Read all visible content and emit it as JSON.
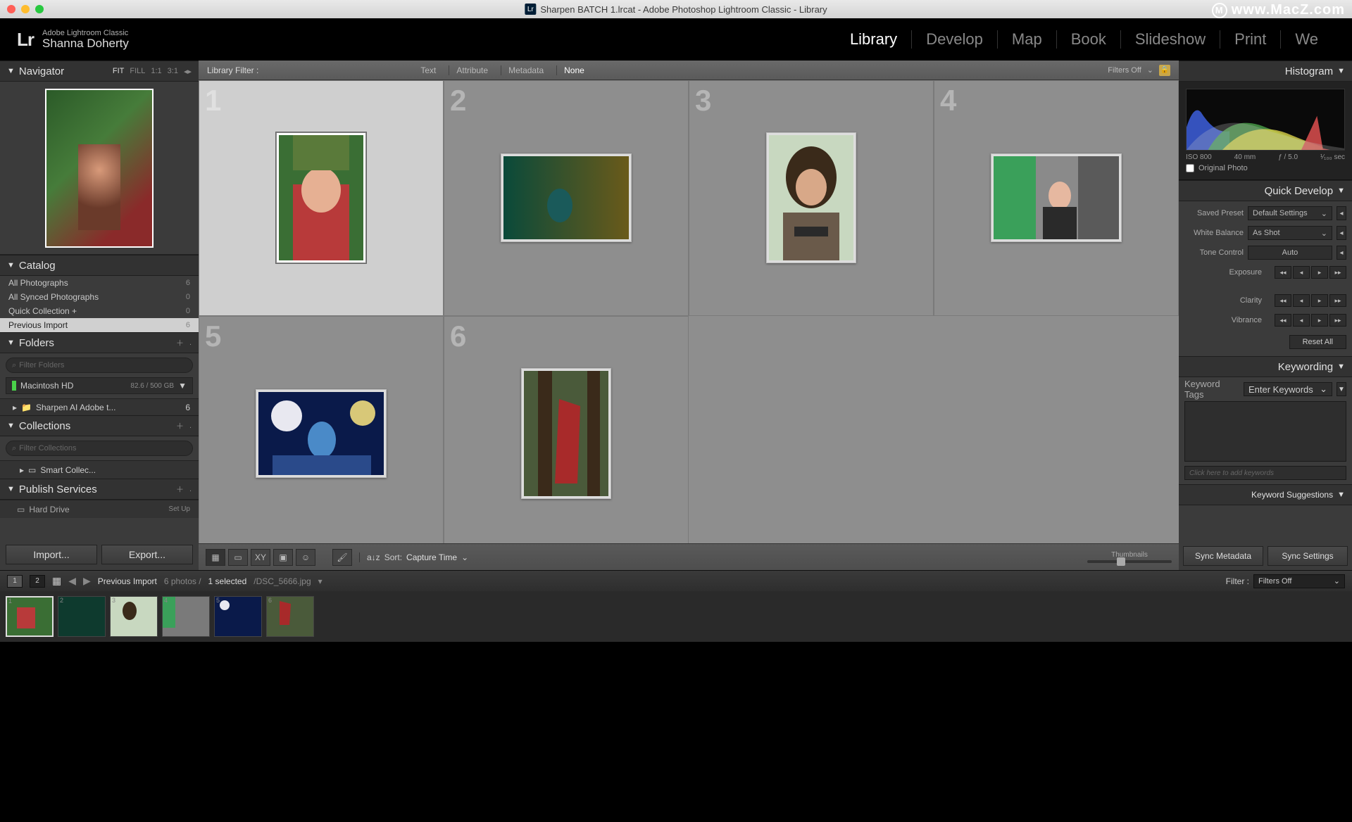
{
  "window_title": "Sharpen BATCH 1.lrcat - Adobe Photoshop Lightroom Classic - Library",
  "watermark": "www.MacZ.com",
  "identity": {
    "brand": "Lr",
    "product": "Adobe Lightroom Classic",
    "user": "Shanna Doherty"
  },
  "modules": [
    "Library",
    "Develop",
    "Map",
    "Book",
    "Slideshow",
    "Print",
    "We"
  ],
  "active_module": "Library",
  "navigator": {
    "title": "Navigator",
    "zoom_opts": [
      "FIT",
      "FILL",
      "1:1",
      "3:1"
    ],
    "zoom_active": "FIT"
  },
  "catalog": {
    "title": "Catalog",
    "items": [
      {
        "label": "All Photographs",
        "count": "6"
      },
      {
        "label": "All Synced Photographs",
        "count": "0"
      },
      {
        "label": "Quick Collection  +",
        "count": "0"
      },
      {
        "label": "Previous Import",
        "count": "6",
        "selected": true
      }
    ]
  },
  "folders": {
    "title": "Folders",
    "filter_placeholder": "Filter Folders",
    "disk": {
      "name": "Macintosh HD",
      "usage": "82.6 / 500 GB"
    },
    "items": [
      {
        "label": "Sharpen AI Adobe t...",
        "count": "6"
      }
    ]
  },
  "collections": {
    "title": "Collections",
    "filter_placeholder": "Filter Collections",
    "items": [
      {
        "label": "Smart Collec..."
      }
    ]
  },
  "publish": {
    "title": "Publish Services",
    "items": [
      {
        "label": "Hard Drive",
        "action": "Set Up"
      }
    ]
  },
  "import_btn": "Import...",
  "export_btn": "Export...",
  "library_filter": {
    "label": "Library Filter :",
    "options": [
      "Text",
      "Attribute",
      "Metadata",
      "None"
    ],
    "active": "None",
    "status": "Filters Off"
  },
  "grid_photos": [
    {
      "n": "1",
      "selected": true,
      "orient": "portrait"
    },
    {
      "n": "2",
      "orient": "landscape"
    },
    {
      "n": "3",
      "orient": "portrait"
    },
    {
      "n": "4",
      "orient": "landscape"
    },
    {
      "n": "5",
      "orient": "landscape"
    },
    {
      "n": "6",
      "orient": "portrait"
    }
  ],
  "toolbar": {
    "sort_label": "Sort:",
    "sort_value": "Capture Time",
    "thumbnails_label": "Thumbnails"
  },
  "histogram": {
    "title": "Histogram",
    "iso": "ISO 800",
    "focal": "40 mm",
    "aperture": "ƒ / 5.0",
    "shutter": "¹⁄₁₀₀ sec",
    "original_label": "Original Photo"
  },
  "quick_develop": {
    "title": "Quick Develop",
    "saved_preset_label": "Saved Preset",
    "saved_preset_value": "Default Settings",
    "white_balance_label": "White Balance",
    "white_balance_value": "As Shot",
    "tone_control_label": "Tone Control",
    "auto_label": "Auto",
    "exposure_label": "Exposure",
    "clarity_label": "Clarity",
    "vibrance_label": "Vibrance",
    "reset_label": "Reset All"
  },
  "keywording": {
    "title": "Keywording",
    "tags_label": "Keyword Tags",
    "tags_mode": "Enter Keywords",
    "add_placeholder": "Click here to add keywords",
    "suggestions_title": "Keyword Suggestions"
  },
  "sync": {
    "meta": "Sync Metadata",
    "settings": "Sync Settings"
  },
  "info_bar": {
    "context": "Previous Import",
    "counts": "6 photos /",
    "selected": "1 selected",
    "file": "/DSC_5666.jpg",
    "filter_label": "Filter :",
    "filter_value": "Filters Off"
  }
}
